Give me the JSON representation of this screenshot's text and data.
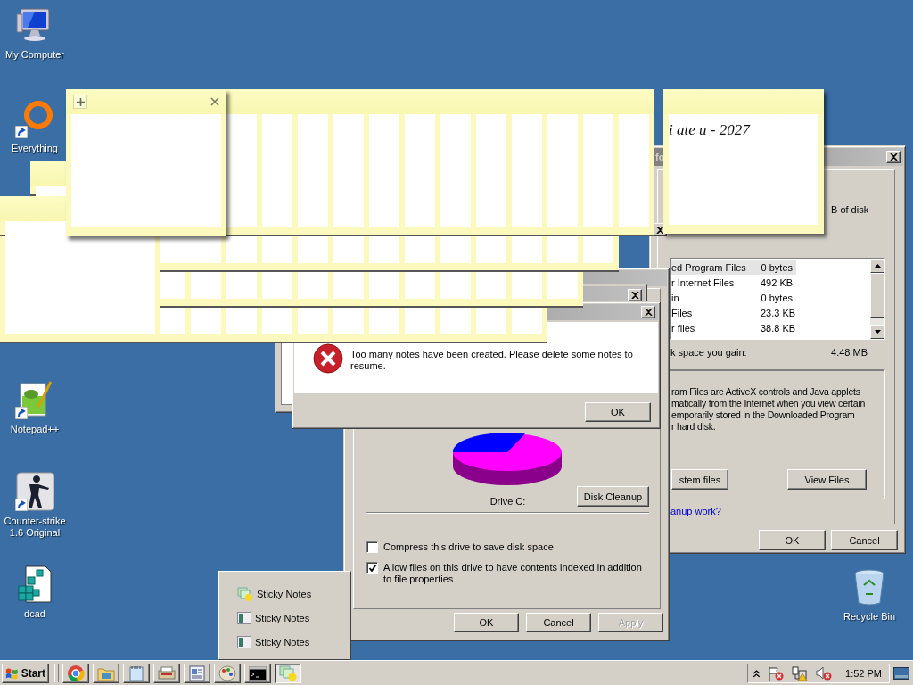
{
  "desktop_icons": [
    {
      "label": "My Computer",
      "kind": "computer",
      "shortcut": false
    },
    {
      "label": "Everything",
      "kind": "ring",
      "shortcut": true
    },
    {
      "label": "Notepad++",
      "kind": "notepad",
      "shortcut": true
    },
    {
      "label": "Counter-strike 1.6 Original",
      "kind": "game",
      "shortcut": true
    },
    {
      "label": "dcad",
      "kind": "cubes",
      "shortcut": false
    },
    {
      "label": "Recycle Bin",
      "kind": "bin",
      "shortcut": false
    }
  ],
  "sticky_note": {
    "text": "i ate u - 2027"
  },
  "cleanup_window": {
    "title": "fo",
    "header_fragment": "B of disk",
    "files": [
      {
        "name": "ed Program Files",
        "size": "0 bytes",
        "selected": true
      },
      {
        "name": "r Internet Files",
        "size": "492 KB",
        "selected": false
      },
      {
        "name": "in",
        "size": "0 bytes",
        "selected": false
      },
      {
        "name": "Files",
        "size": "23.3 KB",
        "selected": false
      },
      {
        "name": "r files",
        "size": "38.8 KB",
        "selected": false
      }
    ],
    "gain_label": "k space you gain:",
    "gain_value": "4.48 MB",
    "description_lines": [
      "ram Files are ActiveX controls and Java applets",
      "matically from the Internet when you view certain",
      "emporarily stored in the Downloaded Program",
      "r hard disk."
    ],
    "system_files_button": "stem files",
    "view_files_button": "View Files",
    "link": "anup work?",
    "buttons": [
      "OK",
      "Cancel"
    ]
  },
  "properties_window": {
    "drive_label": "Drive C:",
    "disk_cleanup_button": "Disk Cleanup",
    "options": [
      {
        "label": "Compress this drive to save disk space",
        "checked": false
      },
      {
        "label": "Allow files on this drive to have contents indexed in addition to file properties",
        "checked": true
      }
    ],
    "buttons": [
      {
        "label": "OK",
        "disabled": false
      },
      {
        "label": "Cancel",
        "disabled": false
      },
      {
        "label": "Apply",
        "disabled": true
      }
    ]
  },
  "error_dialog": {
    "message": "Too many notes have been created. Please delete some notes to resume.",
    "button": "OK"
  },
  "jump_menu": {
    "items": [
      {
        "label": "Sticky Notes",
        "kind": "app"
      },
      {
        "label": "Sticky Notes",
        "kind": "note"
      },
      {
        "label": "Sticky Notes",
        "kind": "note"
      }
    ]
  },
  "taskbar": {
    "start": "Start",
    "buttons": [
      {
        "kind": "chrome",
        "selected": false
      },
      {
        "kind": "folder",
        "selected": false
      },
      {
        "kind": "notepad",
        "selected": false
      },
      {
        "kind": "printer",
        "selected": false
      },
      {
        "kind": "document",
        "selected": false
      },
      {
        "kind": "paint",
        "selected": false
      },
      {
        "kind": "console",
        "selected": false
      },
      {
        "kind": "notes",
        "selected": true
      }
    ],
    "clock": "1:52 PM"
  }
}
